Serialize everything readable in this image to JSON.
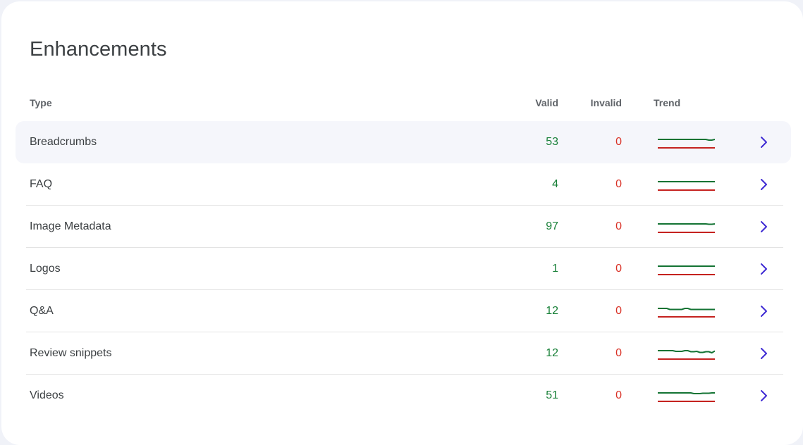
{
  "page_title": "Enhancements",
  "columns": {
    "type": "Type",
    "valid": "Valid",
    "invalid": "Invalid",
    "trend": "Trend"
  },
  "colors": {
    "valid": "#188038",
    "invalid": "#d93025",
    "chevron": "#3f2bd3",
    "trend_valid": "#137333",
    "trend_invalid": "#c5221f"
  },
  "rows": [
    {
      "type": "Breadcrumbs",
      "valid": "53",
      "invalid": "0",
      "highlighted": true,
      "trend_valid": [
        1,
        1,
        1,
        1,
        1,
        1,
        1,
        1,
        1,
        1,
        1,
        1,
        1,
        1,
        1,
        1,
        1,
        0.9,
        0.9,
        1
      ]
    },
    {
      "type": "FAQ",
      "valid": "4",
      "invalid": "0",
      "highlighted": false,
      "trend_valid": [
        1,
        1,
        1,
        1,
        1,
        1,
        1,
        1,
        1,
        1,
        1,
        1,
        1,
        1,
        1,
        1,
        1,
        1,
        1,
        1
      ]
    },
    {
      "type": "Image Metadata",
      "valid": "97",
      "invalid": "0",
      "highlighted": false,
      "trend_valid": [
        1,
        1,
        1,
        1,
        1,
        1,
        1,
        1,
        1,
        1,
        1,
        1,
        1,
        1,
        1,
        1,
        1,
        0.95,
        0.95,
        1
      ]
    },
    {
      "type": "Logos",
      "valid": "1",
      "invalid": "0",
      "highlighted": false,
      "trend_valid": [
        1,
        1,
        1,
        1,
        1,
        1,
        1,
        1,
        1,
        1,
        1,
        1,
        1,
        1,
        1,
        1,
        1,
        1,
        1,
        1
      ]
    },
    {
      "type": "Q&A",
      "valid": "12",
      "invalid": "0",
      "highlighted": false,
      "trend_valid": [
        1,
        1,
        1,
        1,
        0.85,
        0.85,
        0.85,
        0.85,
        0.85,
        1,
        1,
        0.85,
        0.85,
        0.85,
        0.85,
        0.85,
        0.85,
        0.85,
        0.85,
        0.85
      ]
    },
    {
      "type": "Review snippets",
      "valid": "12",
      "invalid": "0",
      "highlighted": false,
      "trend_valid": [
        1,
        1,
        1,
        1,
        1,
        1,
        0.9,
        0.9,
        0.9,
        1,
        1,
        0.85,
        0.85,
        0.9,
        0.75,
        0.75,
        0.85,
        0.85,
        0.7,
        0.95
      ]
    },
    {
      "type": "Videos",
      "valid": "51",
      "invalid": "0",
      "highlighted": false,
      "trend_valid": [
        1,
        1,
        1,
        1,
        1,
        1,
        1,
        1,
        1,
        1,
        1,
        1,
        0.9,
        0.9,
        0.9,
        0.95,
        0.95,
        0.95,
        1,
        1
      ]
    }
  ]
}
